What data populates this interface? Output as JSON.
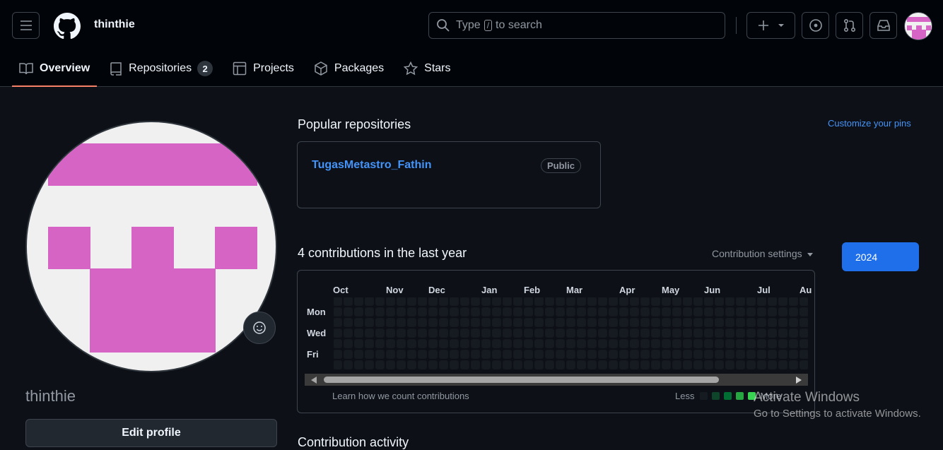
{
  "header": {
    "username": "thinthie",
    "search_prefix": "Type",
    "search_key": "/",
    "search_suffix": "to search"
  },
  "nav": {
    "tabs": [
      {
        "label": "Overview",
        "icon": "book-icon",
        "active": true
      },
      {
        "label": "Repositories",
        "icon": "repo-icon",
        "count": "2"
      },
      {
        "label": "Projects",
        "icon": "table-icon"
      },
      {
        "label": "Packages",
        "icon": "package-icon"
      },
      {
        "label": "Stars",
        "icon": "star-icon"
      }
    ]
  },
  "profile": {
    "name": "thinthie",
    "edit_label": "Edit profile",
    "avatar_color": "#d564c4"
  },
  "popular": {
    "title": "Popular repositories",
    "customize": "Customize your pins",
    "repos": [
      {
        "name": "TugasMetastro_Fathin",
        "visibility": "Public"
      }
    ]
  },
  "contributions": {
    "title": "4 contributions in the last year",
    "settings": "Contribution settings",
    "year": "2024",
    "months": [
      "Oct",
      "Nov",
      "Dec",
      "Jan",
      "Feb",
      "Mar",
      "Apr",
      "May",
      "Jun",
      "Jul",
      "Au"
    ],
    "days": [
      "Mon",
      "Wed",
      "Fri"
    ],
    "learn": "Learn how we count contributions",
    "less": "Less",
    "more": "More",
    "legend_colors": [
      "#161b22",
      "#0e4429",
      "#006d32",
      "#26a641",
      "#39d353"
    ]
  },
  "activity": {
    "title": "Contribution activity"
  },
  "watermark": {
    "line1": "Activate Windows",
    "line2": "Go to Settings to activate Windows."
  }
}
